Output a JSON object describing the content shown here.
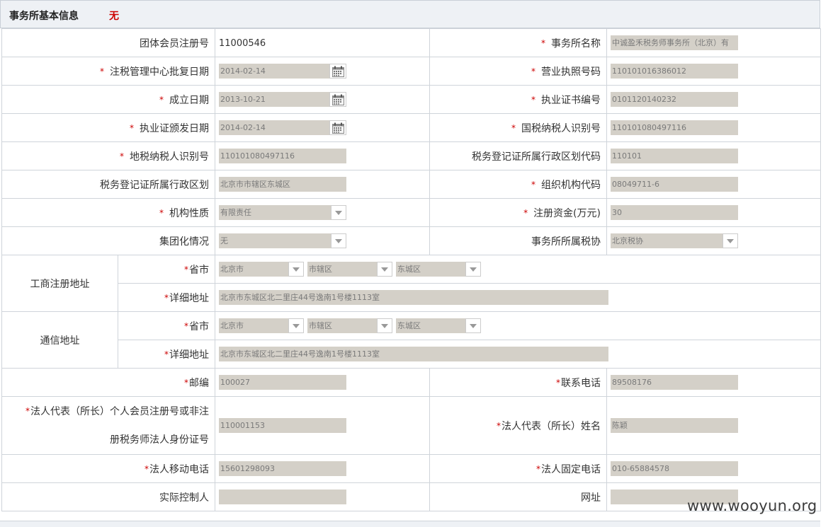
{
  "header": {
    "title": "事务所基本信息",
    "status": "无"
  },
  "row1": {
    "l1": "团体会员注册号",
    "v1": "11000546",
    "l2": "事务所名称",
    "v2": "中诚盈禾税务师事务所（北京）有"
  },
  "row2": {
    "l1": "注税管理中心批复日期",
    "v1": "2014-02-14",
    "l2": "营业执照号码",
    "v2": "110101016386012"
  },
  "row3": {
    "l1": "成立日期",
    "v1": "2013-10-21",
    "l2": "执业证书编号",
    "v2": "0101120140232"
  },
  "row4": {
    "l1": "执业证颁发日期",
    "v1": "2014-02-14",
    "l2": "国税纳税人识别号",
    "v2": "110101080497116"
  },
  "row5": {
    "l1": "地税纳税人识别号",
    "v1": "110101080497116",
    "l2": "税务登记证所属行政区划代码",
    "v2": "110101"
  },
  "row6": {
    "l1": "税务登记证所属行政区划",
    "v1": "北京市市辖区东城区",
    "l2": "组织机构代码",
    "v2": "08049711-6"
  },
  "row7": {
    "l1": "机构性质",
    "v1": "有限责任",
    "l2": "注册资金(万元)",
    "v2": "30"
  },
  "row8": {
    "l1": "集团化情况",
    "v1": "无",
    "l2": "事务所所属税协",
    "v2": "北京税协"
  },
  "biz_addr": {
    "group_label": "工商注册地址",
    "prov_label": "省市",
    "province": "北京市",
    "city": "市辖区",
    "district": "东城区",
    "detail_label": "详细地址",
    "detail": "北京市东城区北二里庄44号逸南1号楼1113室"
  },
  "mail_addr": {
    "group_label": "通信地址",
    "prov_label": "省市",
    "province": "北京市",
    "city": "市辖区",
    "district": "东城区",
    "detail_label": "详细地址",
    "detail": "北京市东城区北二里庄44号逸南1号楼1113室"
  },
  "row11": {
    "l1": "邮编",
    "v1": "100027",
    "l2": "联系电话",
    "v2": "89508176"
  },
  "row12": {
    "l1_line1": "法人代表（所长）个人会员注册号或非注",
    "l1_line2": "册税务师法人身份证号",
    "v1": "110001153",
    "l2": "法人代表（所长）姓名",
    "v2": "陈颖"
  },
  "row13": {
    "l1": "法人移动电话",
    "v1": "15601298093",
    "l2": "法人固定电话",
    "v2": "010-65884578"
  },
  "row14": {
    "l1": "实际控制人",
    "v1": "",
    "l2": "网址",
    "v2": ""
  },
  "required_mark": "*",
  "watermark": "www.wooyun.org",
  "colors": {
    "required": "#cc0000",
    "input_bg": "#d4d0c8",
    "header_bg": "#eef1f5"
  }
}
